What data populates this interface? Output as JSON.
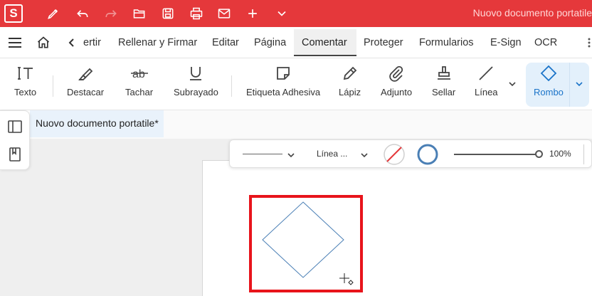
{
  "app": {
    "logo_letter": "S",
    "window_title": "Nuovo documento portatile"
  },
  "quick_access": [
    {
      "name": "pen-icon"
    },
    {
      "name": "undo-icon"
    },
    {
      "name": "redo-icon"
    },
    {
      "name": "open-folder-icon"
    },
    {
      "name": "save-icon"
    },
    {
      "name": "print-icon"
    },
    {
      "name": "mail-icon"
    },
    {
      "name": "plus-icon"
    },
    {
      "name": "chevron-down-icon"
    }
  ],
  "menu": {
    "items": [
      "ertir",
      "Rellenar y Firmar",
      "Editar",
      "Página",
      "Comentar",
      "Proteger",
      "Formularios",
      "E-Sign",
      "OCR"
    ],
    "active": "Comentar"
  },
  "ribbon": {
    "tools": [
      {
        "label": "Texto",
        "icon": "text-icon"
      },
      {
        "label": "Destacar",
        "icon": "highlighter-icon"
      },
      {
        "label": "Tachar",
        "icon": "strikethrough-icon"
      },
      {
        "label": "Subrayado",
        "icon": "underline-icon"
      },
      {
        "label": "Etiqueta Adhesiva",
        "icon": "sticky-note-icon"
      },
      {
        "label": "Lápiz",
        "icon": "pencil-icon"
      },
      {
        "label": "Adjunto",
        "icon": "paperclip-icon"
      },
      {
        "label": "Sellar",
        "icon": "stamp-icon"
      },
      {
        "label": "Línea",
        "icon": "line-icon"
      },
      {
        "label": "Rombo",
        "icon": "diamond-icon"
      }
    ],
    "active_tool": "Rombo"
  },
  "document": {
    "tab_title": "Nuovo documento portatile*"
  },
  "properties": {
    "line_type_label": "Línea ...",
    "zoom": "100%",
    "fill_color": "none",
    "stroke_color": "#4a7fb5"
  },
  "colors": {
    "brand": "#e5383b",
    "accent": "#1a73c8",
    "shape_stroke": "#4a7fb5",
    "highlight": "#e8141b"
  }
}
